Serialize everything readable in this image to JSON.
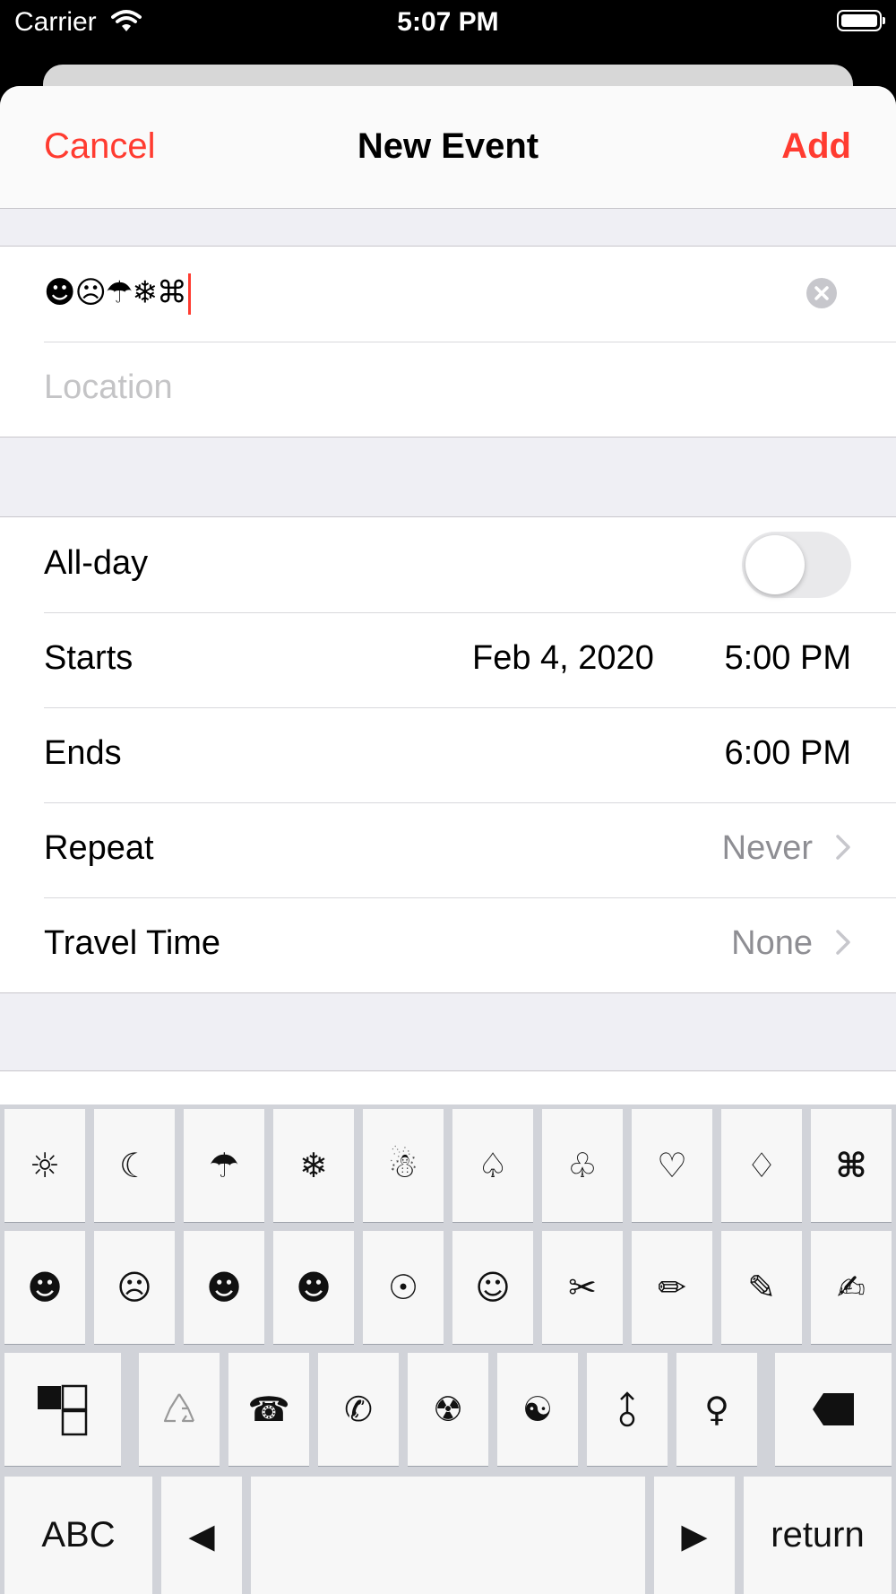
{
  "status_bar": {
    "carrier": "Carrier",
    "time": "5:07 PM"
  },
  "nav": {
    "cancel": "Cancel",
    "title": "New Event",
    "add": "Add"
  },
  "title_field": {
    "value": "☻☹☂❄⌘"
  },
  "location_field": {
    "placeholder": "Location"
  },
  "all_day": {
    "label": "All-day",
    "on": false
  },
  "starts": {
    "label": "Starts",
    "date": "Feb 4, 2020",
    "time": "5:00 PM"
  },
  "ends": {
    "label": "Ends",
    "time": "6:00 PM"
  },
  "repeat": {
    "label": "Repeat",
    "value": "Never"
  },
  "travel_time": {
    "label": "Travel Time",
    "value": "None"
  },
  "colors": {
    "accent": "#ff3b30",
    "placeholder": "#c4c4c6",
    "secondary": "#8e8e93",
    "keyboard_bg": "#d1d3d9"
  },
  "keyboard": {
    "row1": [
      "☼",
      "☾",
      "☂",
      "❄",
      "☃",
      "♤",
      "♧",
      "♡",
      "♢",
      "⌘"
    ],
    "row2": [
      "☻",
      "☹",
      "☻",
      "☻",
      "☉",
      "☺",
      "✂",
      "✏",
      "✎",
      "✍"
    ],
    "row3": [
      "⚛",
      "☎",
      "✆",
      "☢",
      "☯",
      "⚲",
      "♀"
    ],
    "row4": {
      "abc": "ABC",
      "left": "◀",
      "right": "▶",
      "return": "return"
    }
  }
}
